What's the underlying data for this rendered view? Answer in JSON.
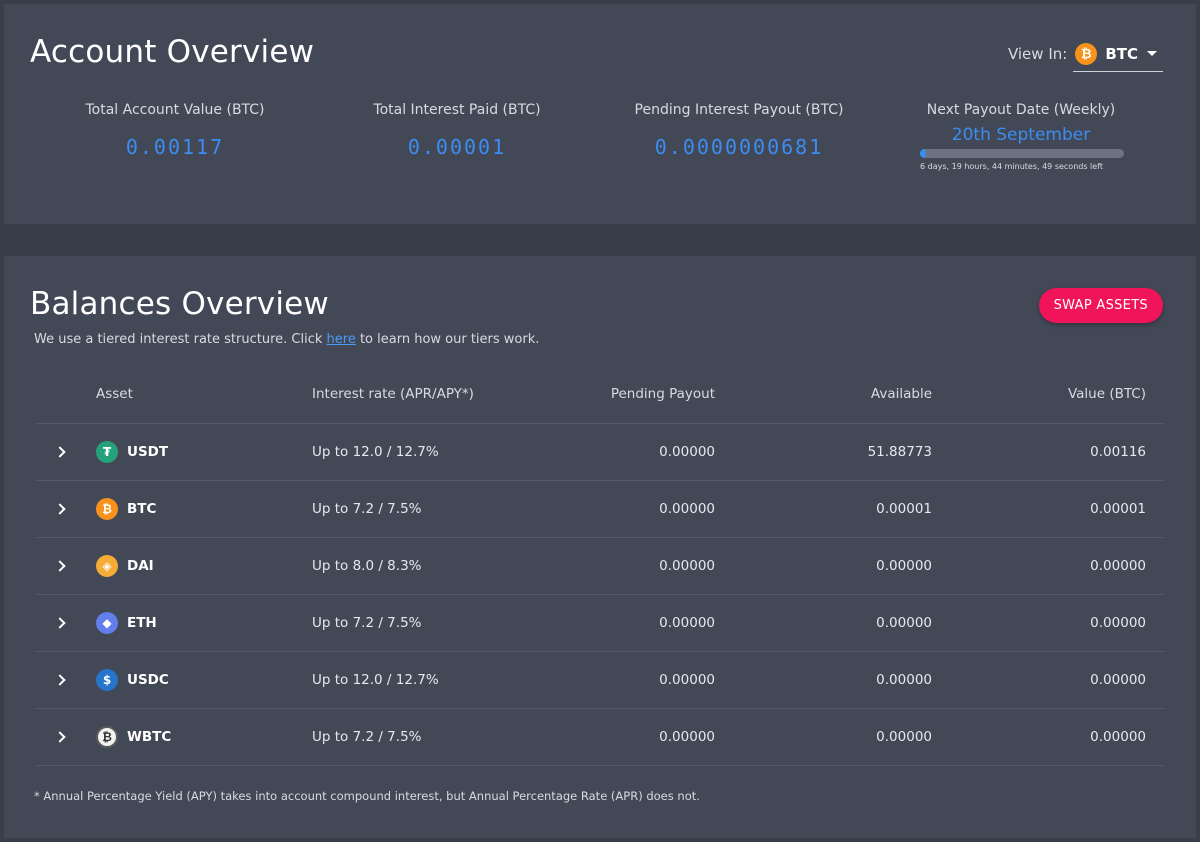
{
  "account": {
    "title": "Account Overview",
    "view_in_label": "View In:",
    "currency": "BTC",
    "stats": {
      "total_label": "Total Account Value (BTC)",
      "total_value": "0.00117",
      "interest_label": "Total Interest Paid (BTC)",
      "interest_value": "0.00001",
      "pending_label": "Pending Interest Payout (BTC)",
      "pending_value": "0.0000000681"
    },
    "payout": {
      "label": "Next Payout Date (Weekly)",
      "date": "20th September",
      "progress_fraction": 0.03,
      "countdown": "6 days, 19 hours, 44 minutes, 49 seconds left"
    }
  },
  "balances": {
    "title": "Balances Overview",
    "swap_label": "SWAP ASSETS",
    "tier_note_before": "We use a tiered interest rate structure. Click ",
    "tier_link": "here",
    "tier_note_after": " to learn how our tiers work.",
    "headers": {
      "asset": "Asset",
      "rate": "Interest rate (APR/APY*)",
      "pending": "Pending Payout",
      "available": "Available",
      "value": "Value (BTC)"
    },
    "rows": [
      {
        "code": "USDT",
        "icon": "tether-icon",
        "glyph": "₮",
        "color": "#26a17b",
        "rate": "Up to 12.0 / 12.7%",
        "pending": "0.00000",
        "available": "51.88773",
        "value": "0.00116"
      },
      {
        "code": "BTC",
        "icon": "bitcoin-icon",
        "glyph": "₿",
        "color": "#f7931a",
        "rate": "Up to 7.2 / 7.5%",
        "pending": "0.00000",
        "available": "0.00001",
        "value": "0.00001"
      },
      {
        "code": "DAI",
        "icon": "dai-icon",
        "glyph": "◈",
        "color": "#f5ac37",
        "rate": "Up to 8.0 / 8.3%",
        "pending": "0.00000",
        "available": "0.00000",
        "value": "0.00000"
      },
      {
        "code": "ETH",
        "icon": "ethereum-icon",
        "glyph": "◆",
        "color": "#627eea",
        "rate": "Up to 7.2 / 7.5%",
        "pending": "0.00000",
        "available": "0.00000",
        "value": "0.00000"
      },
      {
        "code": "USDC",
        "icon": "usdc-icon",
        "glyph": "$",
        "color": "#2775ca",
        "rate": "Up to 12.0 / 12.7%",
        "pending": "0.00000",
        "available": "0.00000",
        "value": "0.00000"
      },
      {
        "code": "WBTC",
        "icon": "wbtc-icon",
        "glyph": "₿",
        "color": "#f2f2f2",
        "rate": "Up to 7.2 / 7.5%",
        "pending": "0.00000",
        "available": "0.00000",
        "value": "0.00000"
      }
    ],
    "footnote": "* Annual Percentage Yield (APY) takes into account compound interest, but Annual Percentage Rate (APR) does not."
  }
}
